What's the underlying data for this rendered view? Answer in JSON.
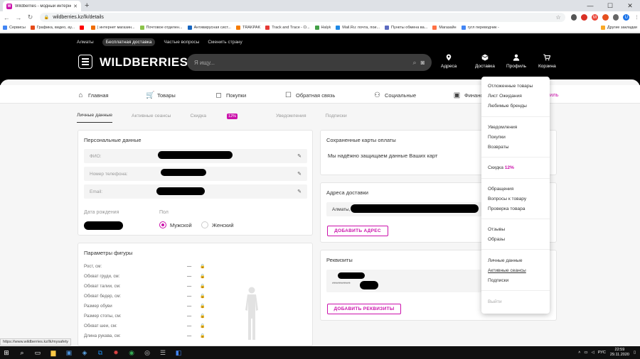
{
  "browser": {
    "tab_title": "Wildberries - модный интерне...",
    "url": "wildberries.kz/lk/details",
    "bookmarks": [
      "Сервисы",
      "Графика, видео, ау...",
      "",
      "| интернет магазин...",
      "Почтовое отделен...",
      "Антивирусная сист...",
      "TRAKPAK",
      "Track and Trace - O...",
      "Halyk",
      "Mail.Ru: почта, пои...",
      "Пункты обмена ва...",
      "Магазайн",
      "гугл переводчик -"
    ],
    "bookmarks_other": "Другие закладки",
    "bookmark_colors": [
      "#4285f4",
      "#e64a19",
      "#ff0000",
      "#ef6c00",
      "#8bc34a",
      "#1565c0",
      "#f57c00",
      "#e53935",
      "#43a047",
      "#1e88e5",
      "#5c6bc0",
      "#ff7043",
      "#4285f4"
    ]
  },
  "site": {
    "toplinks": [
      "Алматы",
      "Бесплатная доставка",
      "Частые вопросы",
      "Сменить страну"
    ],
    "logo": "WILDBERRIES",
    "search_placeholder": "Я ищу...",
    "header_nav": [
      {
        "label": "Адреса",
        "icon": "location-pin-icon"
      },
      {
        "label": "Доставка",
        "icon": "box-icon"
      },
      {
        "label": "Профиль",
        "icon": "person-icon"
      },
      {
        "label": "Корзина",
        "icon": "cart-icon"
      }
    ],
    "categories": [
      {
        "label": "Главная",
        "icon": "home-icon"
      },
      {
        "label": "Товары",
        "icon": "cart-icon"
      },
      {
        "label": "Покупки",
        "icon": "bag-icon"
      },
      {
        "label": "Обратная связь",
        "icon": "chat-icon"
      },
      {
        "label": "Социальные",
        "icon": "people-icon"
      },
      {
        "label": "Финансы",
        "icon": "wallet-icon"
      },
      {
        "label": "иль",
        "icon": ""
      }
    ],
    "subtabs": [
      "Личные данные",
      "Активные сеансы",
      "Скидка",
      "Уведомления",
      "Подписки"
    ],
    "subtab_badge": "12%"
  },
  "personal": {
    "title": "Персональные данные",
    "fields": [
      {
        "label": "ФИО:"
      },
      {
        "label": "Номер телефона:"
      },
      {
        "label": "Email:"
      }
    ],
    "birth_label": "Дата рождения",
    "gender_label": "Пол",
    "gender_options": [
      "Мужской",
      "Женский"
    ],
    "gender_selected": "Мужской"
  },
  "figure": {
    "title": "Параметры фигуры",
    "rows": [
      "Рост, см:",
      "Обхват груди, см:",
      "Обхват талии, см:",
      "Обхват бедер, см:",
      "Размер обуви",
      "Размер стопы, см:",
      "Обхват шеи, см:",
      "Длина рукава, см:"
    ],
    "dash": "—"
  },
  "cards": {
    "title": "Сохраненные карты оплаты",
    "text": "Мы надёжно защищаем данные Ваших карт"
  },
  "address": {
    "title": "Адреса доставки",
    "value": "Алматы,",
    "button": "ДОБАВИТЬ АДРЕС"
  },
  "requisites": {
    "title": "Реквизиты",
    "masked": "***********",
    "button": "ДОБАВИТЬ РЕКВИЗИТЫ"
  },
  "dropdown": {
    "groups": [
      [
        "Отложенные товары",
        "Лист Ожидания",
        "Любимые бренды"
      ],
      [
        "Уведомления",
        "Покупки",
        "Возвраты"
      ],
      [
        "Скидка"
      ],
      [
        "Обращения",
        "Вопросы к товару",
        "Проверка товара"
      ],
      [
        "Отзывы",
        "Образы"
      ],
      [
        "Личные данные",
        "Активные сеансы",
        "Подписки"
      ],
      [
        "Выйти"
      ]
    ],
    "discount": "12%"
  },
  "status_url": "https://www.wildberries.kz/lk/mysafety",
  "taskbar": {
    "lang": "РУС",
    "time": "22:59",
    "date": "29.11.2020"
  },
  "colors": {
    "accent": "#cb11ab",
    "header": "#000000"
  }
}
